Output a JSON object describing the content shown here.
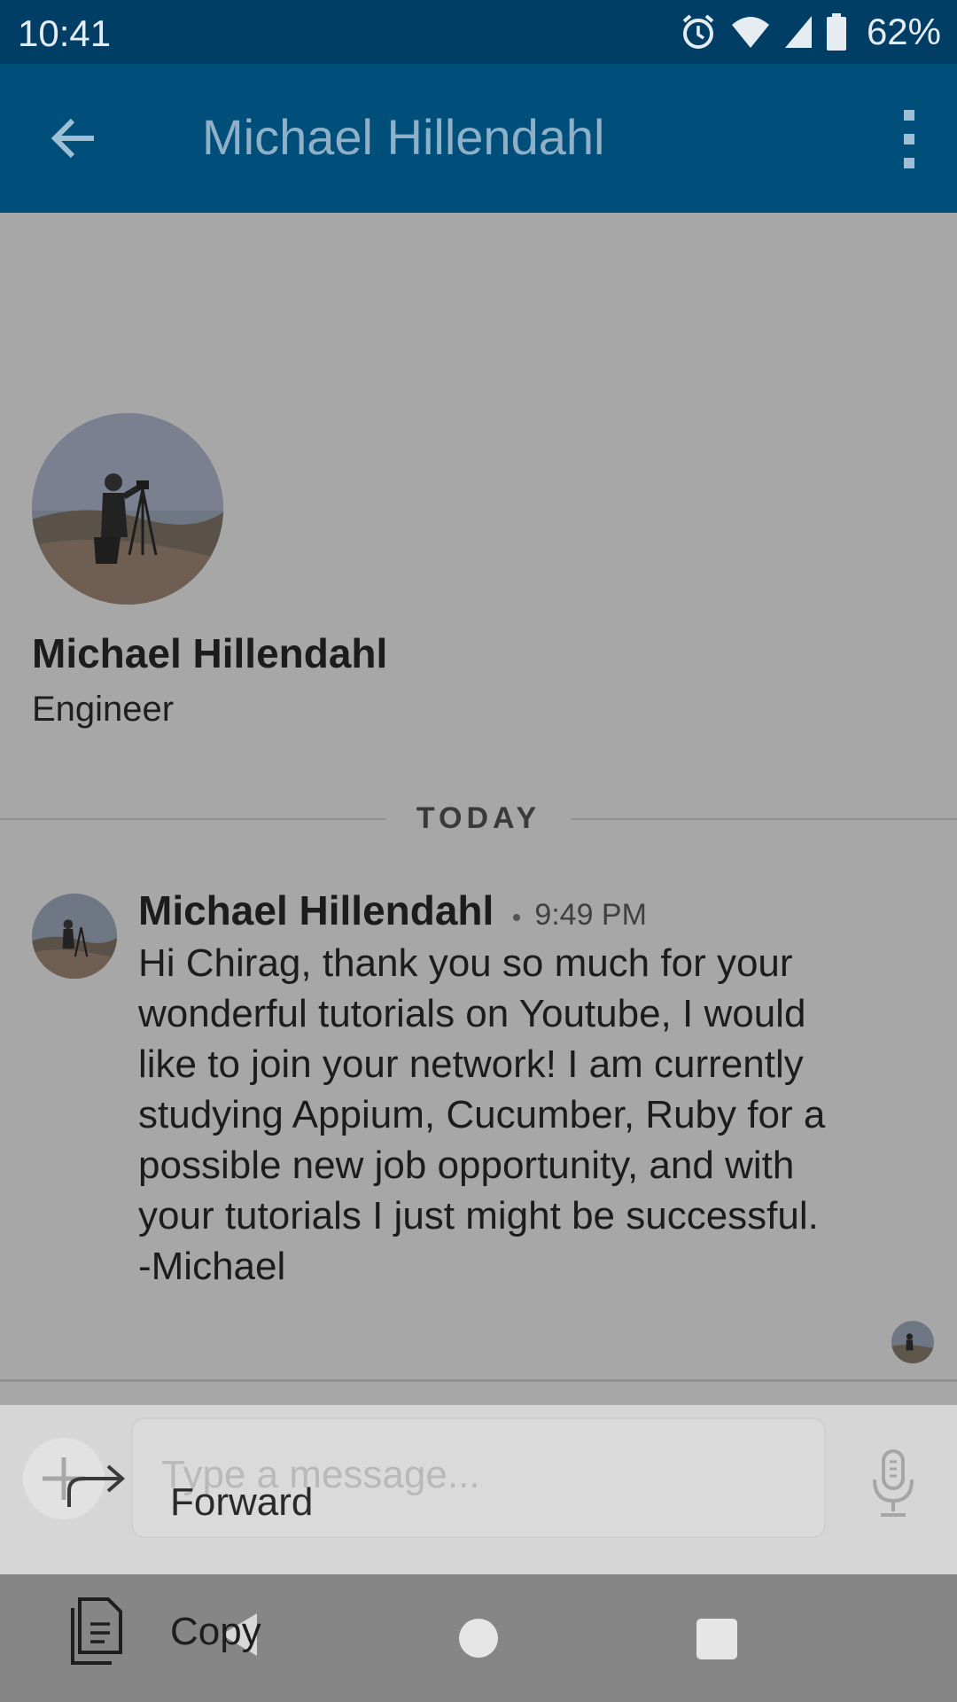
{
  "status_bar": {
    "time": "10:41",
    "battery_percent": "62%",
    "icons": [
      "alarm-icon",
      "wifi-icon",
      "signal-icon",
      "battery-icon"
    ]
  },
  "app_bar": {
    "title": "Michael Hillendahl",
    "back_icon": "arrow-back-icon",
    "menu_icon": "more-vert-icon"
  },
  "profile": {
    "name": "Michael Hillendahl",
    "headline": "Engineer"
  },
  "divider": {
    "label": "TODAY"
  },
  "message": {
    "sender": "Michael Hillendahl",
    "time": "9:49 PM",
    "text": "Hi Chirag, thank you so much for your\nwonderful tutorials on Youtube, I would\nlike to join your network! I am currently\nstudying Appium, Cucumber, Ruby for a\npossible new job opportunity, and with\nyour tutorials I just might be successful.\n-Michael"
  },
  "composer": {
    "placeholder": "Type a message...",
    "value": ""
  },
  "context_menu": {
    "forward_label": "Forward",
    "copy_label": "Copy"
  },
  "colors": {
    "status_bar": "#003e66",
    "app_bar": "#004f7a",
    "background_dimmed": "#a7a7a7"
  }
}
